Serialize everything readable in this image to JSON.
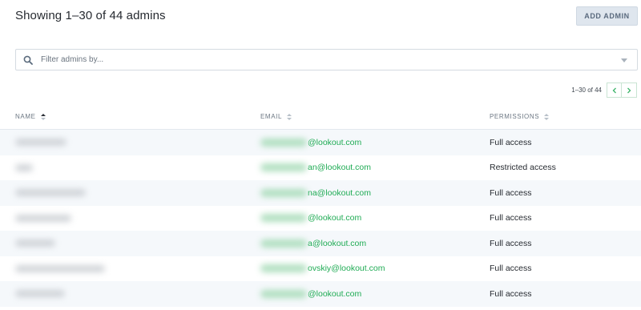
{
  "header": {
    "title": "Showing 1–30 of 44 admins",
    "add_button": "ADD ADMIN"
  },
  "filter": {
    "placeholder": "Filter admins by...",
    "value": ""
  },
  "pagination": {
    "count": "1–30 of 44",
    "prev_icon": "chevron-left-icon",
    "next_icon": "chevron-right-icon"
  },
  "table": {
    "columns": [
      {
        "label": "NAME",
        "sort": "ascending"
      },
      {
        "label": "EMAIL",
        "sort": "none"
      },
      {
        "label": "PERMISSIONS",
        "sort": "none"
      }
    ],
    "rows": [
      {
        "email_visible": "@lookout.com",
        "permissions": "Full access"
      },
      {
        "email_visible": "an@lookout.com",
        "permissions": "Restricted access"
      },
      {
        "email_visible": "na@lookout.com",
        "permissions": "Full access"
      },
      {
        "email_visible": "@lookout.com",
        "permissions": "Full access"
      },
      {
        "email_visible": "a@lookout.com",
        "permissions": "Full access"
      },
      {
        "email_visible": "ovskiy@lookout.com",
        "permissions": "Full access"
      },
      {
        "email_visible": "@lookout.com",
        "permissions": "Full access"
      }
    ]
  },
  "colors": {
    "email_link": "#1fab54",
    "button_bg": "#dfe6ee",
    "row_alt": "#f5f8fb"
  }
}
